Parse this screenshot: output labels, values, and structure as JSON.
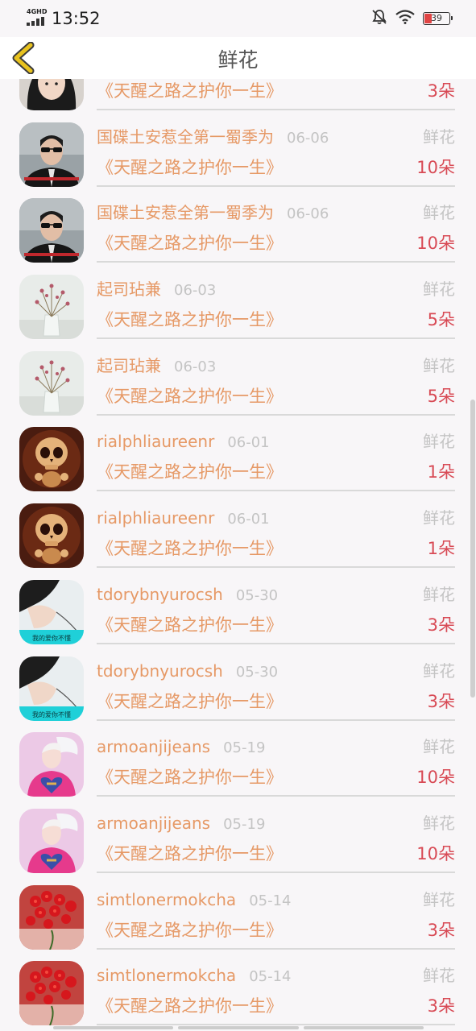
{
  "status_bar": {
    "network": "4GHD",
    "time": "13:52",
    "battery": "39",
    "icons": [
      "signal-icon",
      "bell-muted-icon",
      "wifi-icon",
      "battery-icon"
    ]
  },
  "nav": {
    "back_icon": "chevron-left-icon",
    "title": "鲜花"
  },
  "colors": {
    "name": "#e69966",
    "date": "#c4c4c4",
    "amount": "#d84a55",
    "back_icon": "#e8c21e"
  },
  "items": [
    {
      "name": "",
      "date": "",
      "gift": "",
      "book": "《天醒之路之护你一生》",
      "amount": "3朵",
      "avatar": "girl-avatar"
    },
    {
      "name": "国碟土安惹全第一蜀季为",
      "date": "06-06",
      "gift": "鲜花",
      "book": "《天醒之路之护你一生》",
      "amount": "10朵",
      "avatar": "boy-sunglasses-avatar"
    },
    {
      "name": "国碟土安惹全第一蜀季为",
      "date": "06-06",
      "gift": "鲜花",
      "book": "《天醒之路之护你一生》",
      "amount": "10朵",
      "avatar": "boy-sunglasses-avatar"
    },
    {
      "name": "起司玷兼",
      "date": "06-03",
      "gift": "鲜花",
      "book": "《天醒之路之护你一生》",
      "amount": "5朵",
      "avatar": "flower-vase-avatar"
    },
    {
      "name": "起司玷兼",
      "date": "06-03",
      "gift": "鲜花",
      "book": "《天醒之路之护你一生》",
      "amount": "5朵",
      "avatar": "flower-vase-avatar"
    },
    {
      "name": "rialphliaureenr",
      "date": "06-01",
      "gift": "鲜花",
      "book": "《天醒之路之护你一生》",
      "amount": "1朵",
      "avatar": "skull-avatar"
    },
    {
      "name": "rialphliaureenr",
      "date": "06-01",
      "gift": "鲜花",
      "book": "《天醒之路之护你一生》",
      "amount": "1朵",
      "avatar": "skull-avatar"
    },
    {
      "name": "tdorybnyurocsh",
      "date": "05-30",
      "gift": "鲜花",
      "book": "《天醒之路之护你一生》",
      "amount": "3朵",
      "avatar": "girl-drawing-avatar"
    },
    {
      "name": "tdorybnyurocsh",
      "date": "05-30",
      "gift": "鲜花",
      "book": "《天醒之路之护你一生》",
      "amount": "3朵",
      "avatar": "girl-drawing-avatar"
    },
    {
      "name": "armoanjijeans",
      "date": "05-19",
      "gift": "鲜花",
      "book": "《天醒之路之护你一生》",
      "amount": "10朵",
      "avatar": "cartoon-heart-avatar"
    },
    {
      "name": "armoanjijeans",
      "date": "05-19",
      "gift": "鲜花",
      "book": "《天醒之路之护你一生》",
      "amount": "10朵",
      "avatar": "cartoon-heart-avatar"
    },
    {
      "name": "simtlonermokcha",
      "date": "05-14",
      "gift": "鲜花",
      "book": "《天醒之路之护你一生》",
      "amount": "3朵",
      "avatar": "red-flower-avatar"
    },
    {
      "name": "simtlonermokcha",
      "date": "05-14",
      "gift": "鲜花",
      "book": "《天醒之路之护你一生》",
      "amount": "3朵",
      "avatar": "red-flower-avatar"
    }
  ]
}
